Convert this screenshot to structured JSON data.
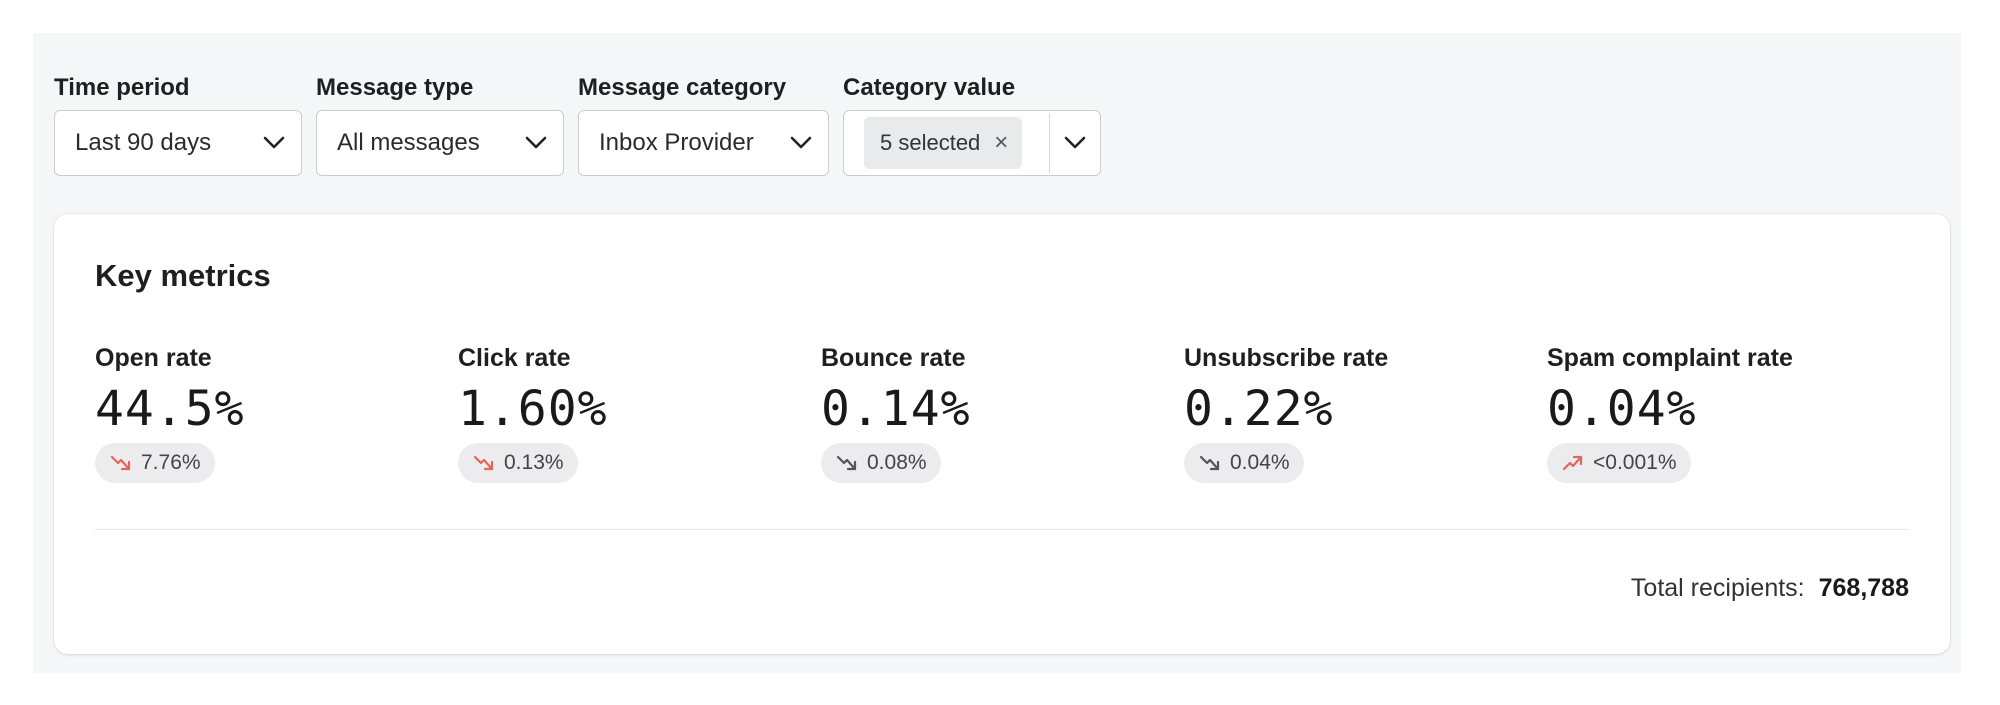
{
  "filters": [
    {
      "label": "Time period",
      "value": "Last 90 days"
    },
    {
      "label": "Message type",
      "value": "All messages"
    },
    {
      "label": "Message category",
      "value": "Inbox Provider"
    },
    {
      "label": "Category value",
      "chip": "5 selected",
      "chip_remove": "×"
    }
  ],
  "card": {
    "title": "Key metrics",
    "metrics": [
      {
        "label": "Open rate",
        "value": "44.5%",
        "delta": "7.76%",
        "trend": "down",
        "trend_color": "#e0675c"
      },
      {
        "label": "Click rate",
        "value": "1.60%",
        "delta": "0.13%",
        "trend": "down",
        "trend_color": "#e0675c"
      },
      {
        "label": "Bounce rate",
        "value": "0.14%",
        "delta": "0.08%",
        "trend": "down",
        "trend_color": "#555555"
      },
      {
        "label": "Unsubscribe rate",
        "value": "0.22%",
        "delta": "0.04%",
        "trend": "down",
        "trend_color": "#555555"
      },
      {
        "label": "Spam complaint rate",
        "value": "0.04%",
        "delta": "<0.001%",
        "trend": "up",
        "trend_color": "#e0675c"
      }
    ],
    "total_label": "Total recipients:",
    "total_value": "768,788"
  },
  "icons": {
    "dropdown": "chevron-down-icon",
    "remove": "close-icon",
    "trend_down": "trend-down-icon",
    "trend_up": "trend-up-icon"
  }
}
